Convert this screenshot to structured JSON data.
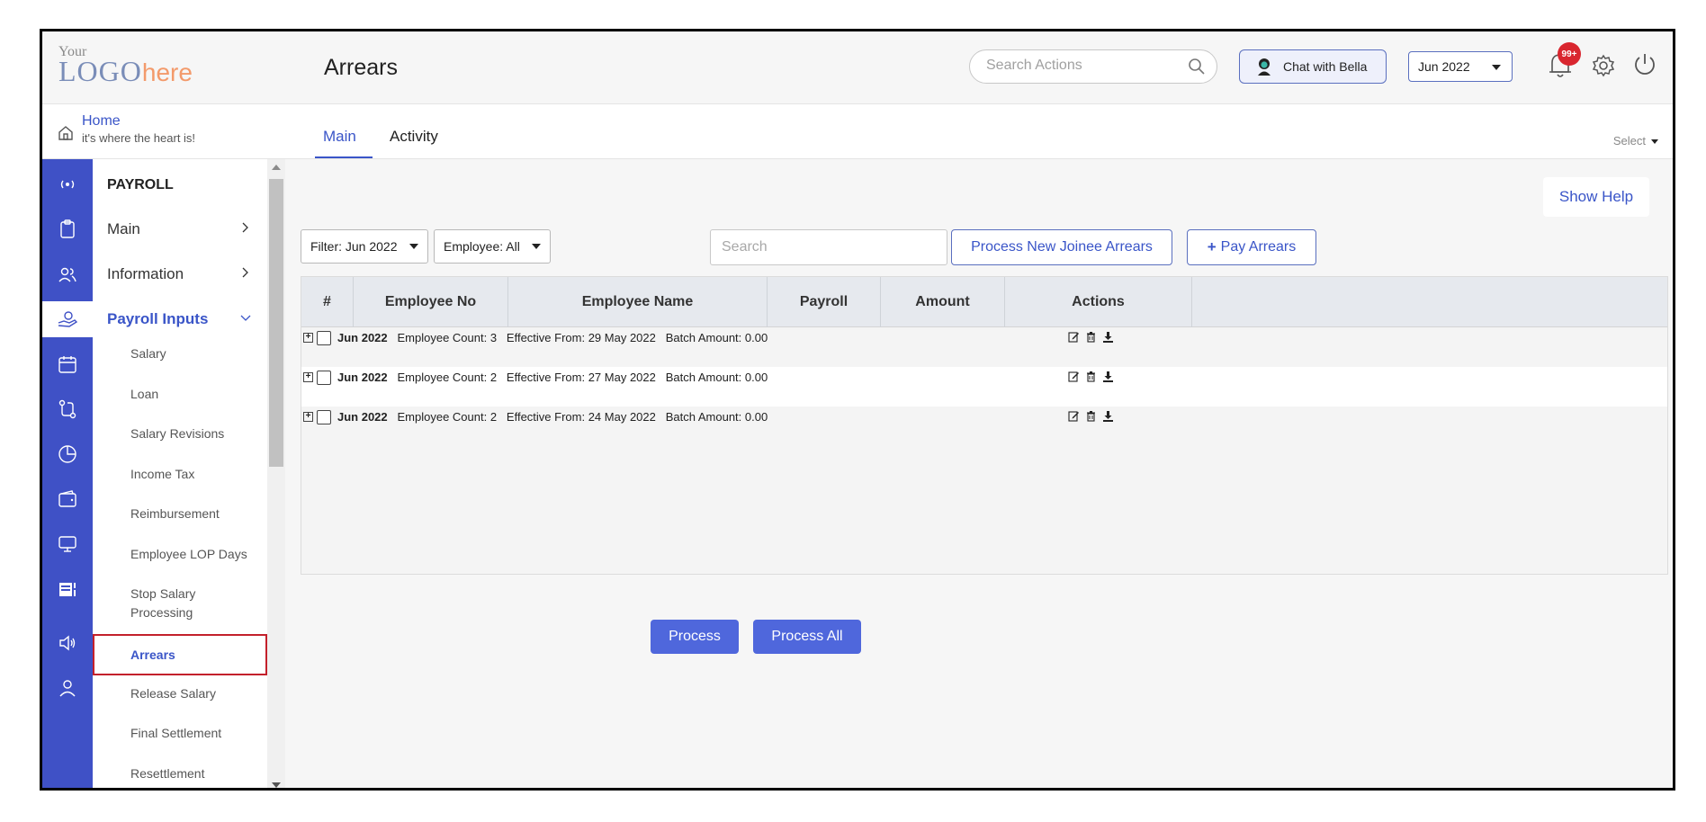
{
  "logo": {
    "line1": "Your",
    "line2a": "LOGO",
    "line2b": "here"
  },
  "header": {
    "title": "Arrears",
    "search_placeholder": "Search Actions",
    "chat_label": "Chat with Bella",
    "month_selected": "Jun 2022",
    "notification_badge": "99+"
  },
  "home": {
    "title": "Home",
    "subtitle": "it's where the heart is!"
  },
  "menu": {
    "section": "PAYROLL",
    "items": [
      {
        "label": "Main"
      },
      {
        "label": "Information"
      },
      {
        "label": "Payroll Inputs"
      }
    ],
    "sub_items": [
      "Salary",
      "Loan",
      "Salary Revisions",
      "Income Tax",
      "Reimbursement",
      "Employee LOP Days",
      "Stop Salary Processing",
      "Arrears",
      "Release Salary",
      "Final Settlement",
      "Resettlement"
    ]
  },
  "tabs": [
    {
      "label": "Main"
    },
    {
      "label": "Activity"
    }
  ],
  "select_label": "Select",
  "show_help": "Show Help",
  "filters": {
    "month": "Filter: Jun 2022",
    "employee": "Employee: All"
  },
  "grid_search_placeholder": "Search",
  "buttons": {
    "process_new_joinee": "Process New Joinee Arrears",
    "pay_arrears": "Pay Arrears",
    "process": "Process",
    "process_all": "Process All"
  },
  "table": {
    "columns": [
      "#",
      "Employee No",
      "Employee Name",
      "Payroll",
      "Amount",
      "Actions"
    ],
    "rows": [
      {
        "month": "Jun 2022",
        "count": "Employee Count: 3",
        "effective": "Effective From: 29 May 2022",
        "batch": "Batch Amount: 0.00"
      },
      {
        "month": "Jun 2022",
        "count": "Employee Count: 2",
        "effective": "Effective From: 27 May 2022",
        "batch": "Batch Amount: 0.00"
      },
      {
        "month": "Jun 2022",
        "count": "Employee Count: 2",
        "effective": "Effective From: 24 May 2022",
        "batch": "Batch Amount: 0.00"
      }
    ]
  },
  "colors": {
    "accent": "#3f51c6",
    "button": "#4f67dc",
    "badge": "#d9262f",
    "highlight_border": "#c3202b"
  },
  "icons": [
    "search-icon",
    "chat-avatar-icon",
    "bell-icon",
    "gear-icon",
    "power-icon",
    "home-icon",
    "edit-icon",
    "trash-icon",
    "download-icon"
  ]
}
